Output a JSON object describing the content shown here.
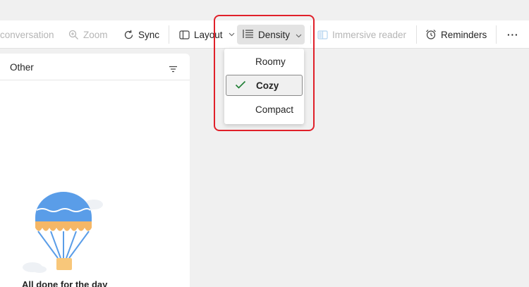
{
  "toolbar": {
    "conversation_label": "conversation",
    "zoom_label": "Zoom",
    "sync_label": "Sync",
    "layout_label": "Layout",
    "density_label": "Density",
    "immersive_label": "Immersive reader",
    "reminders_label": "Reminders",
    "more_label": "···"
  },
  "density_menu": {
    "items": [
      {
        "label": "Roomy",
        "selected": false
      },
      {
        "label": "Cozy",
        "selected": true
      },
      {
        "label": "Compact",
        "selected": false
      }
    ]
  },
  "mail_panel": {
    "title": "Other",
    "empty_message": "All done for the day"
  },
  "colors": {
    "highlight": "#e0202a",
    "balloon_blue": "#5a9de8",
    "balloon_orange": "#f5b766",
    "check_green": "#1e7e34"
  },
  "icons": [
    "zoom-icon",
    "sync-icon",
    "layout-icon",
    "density-icon",
    "immersive-reader-icon",
    "reminders-icon",
    "filter-icon",
    "checkmark-icon",
    "hot-air-balloon-illustration"
  ]
}
